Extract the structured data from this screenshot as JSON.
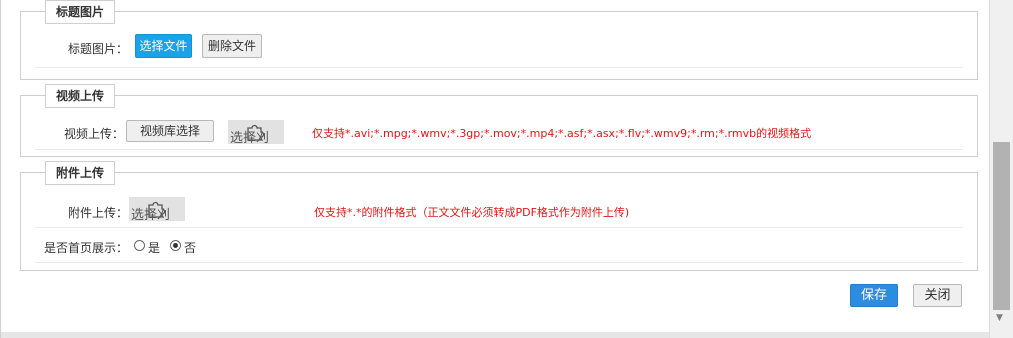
{
  "sections": {
    "title_image": {
      "legend": "标题图片",
      "label": "标题图片：",
      "select_button": "选择文件",
      "delete_button": "删除文件"
    },
    "video_upload": {
      "legend": "视频上传",
      "label": "视频上传：",
      "library_button": "视频库选择",
      "upload_placeholder": "选择刈",
      "note": "仅支持*.avi;*.mpg;*.wmv;*.3gp;*.mov;*.mp4;*.asf;*.asx;*.flv;*.wmv9;*.rm;*.rmvb的视频格式"
    },
    "attachment_upload": {
      "legend": "附件上传",
      "label": "附件上传：",
      "upload_placeholder": "选择刈",
      "note": "仅支持*.*的附件格式（正文文件必须转成PDF格式作为附件上传)",
      "homepage_label": "是否首页展示：",
      "option_yes": "是",
      "option_no": "否",
      "selected": "否"
    }
  },
  "footer": {
    "save_button": "保存",
    "close_button": "关闭"
  },
  "colors": {
    "accent_blue": "#1aa3e6",
    "save_blue": "#2d8ce0",
    "note_red": "#e01515"
  }
}
